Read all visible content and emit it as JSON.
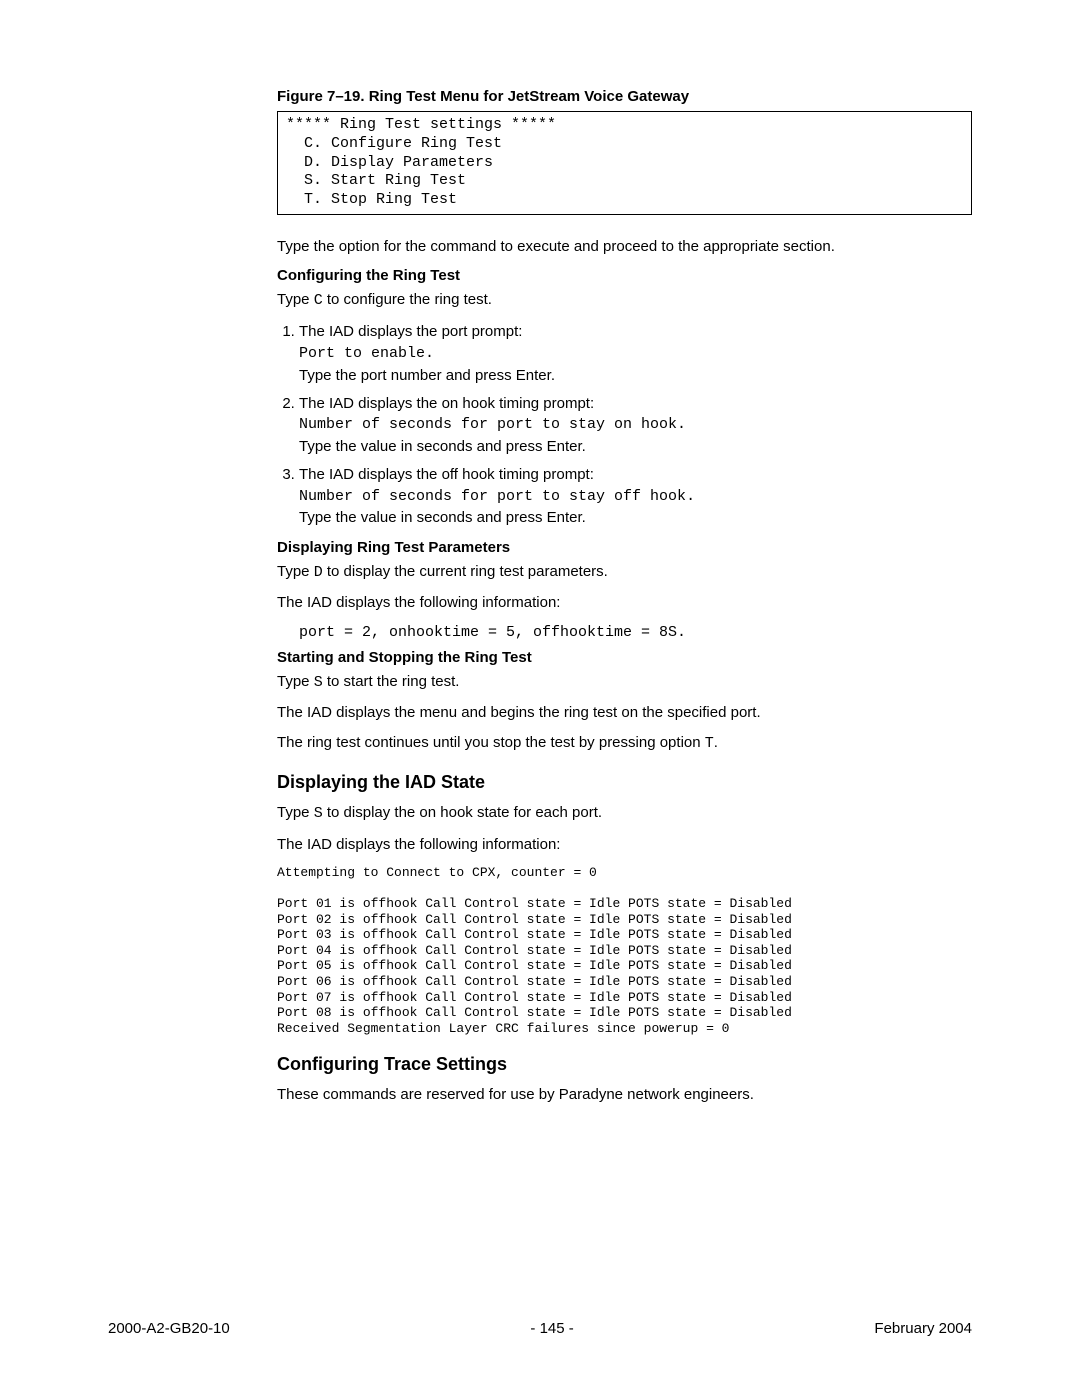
{
  "figure_caption": "Figure 7–19.  Ring Test Menu for JetStream Voice Gateway",
  "terminal": "***** Ring Test settings *****\n  C. Configure Ring Test\n  D. Display Parameters\n  S. Start Ring Test\n  T. Stop Ring Test",
  "intro": "Type the option for the command to execute and proceed to the appropriate section.",
  "config_heading": "Configuring the Ring Test",
  "config_type_prefix": "Type ",
  "config_type_code": "C",
  "config_type_suffix": " to configure the ring test.",
  "steps": [
    {
      "lead": "The IAD displays the port prompt:",
      "code": "Port to enable.",
      "tail": "Type the port number and press Enter."
    },
    {
      "lead": "The IAD displays the on hook timing prompt:",
      "code": "Number of seconds for port to stay on hook.",
      "tail": "Type the value in seconds and press Enter."
    },
    {
      "lead": "The IAD displays the off hook timing prompt:",
      "code": "Number of seconds for port to stay off hook.",
      "tail": "Type the value in seconds and press Enter."
    }
  ],
  "display_params_heading": "Displaying Ring Test Parameters",
  "display_type_prefix": "Type ",
  "display_type_code": "D",
  "display_type_suffix": " to display the current ring test parameters.",
  "display_info": "The IAD displays the following information:",
  "display_output": "port = 2, onhooktime = 5, offhooktime = 8S.",
  "startstop_heading": "Starting and Stopping the Ring Test",
  "start_type_prefix": "Type ",
  "start_type_code": "S",
  "start_type_suffix": " to start the ring test.",
  "start_info": "The IAD displays the menu and begins the ring test on the specified port.",
  "stop_info_prefix": "The ring test continues until you stop the test by pressing option ",
  "stop_info_code": "T",
  "stop_info_suffix": ".",
  "iad_state_heading": "Displaying the IAD State",
  "iad_type_prefix": "Type ",
  "iad_type_code": "S",
  "iad_type_suffix": " to display the on hook state for each port.",
  "iad_info": "The IAD displays the following information:",
  "port_dump": "Attempting to Connect to CPX, counter = 0\n\nPort 01 is offhook Call Control state = Idle POTS state = Disabled\nPort 02 is offhook Call Control state = Idle POTS state = Disabled\nPort 03 is offhook Call Control state = Idle POTS state = Disabled\nPort 04 is offhook Call Control state = Idle POTS state = Disabled\nPort 05 is offhook Call Control state = Idle POTS state = Disabled\nPort 06 is offhook Call Control state = Idle POTS state = Disabled\nPort 07 is offhook Call Control state = Idle POTS state = Disabled\nPort 08 is offhook Call Control state = Idle POTS state = Disabled\nReceived Segmentation Layer CRC failures since powerup = 0",
  "trace_heading": "Configuring Trace Settings",
  "trace_body": "These commands are reserved for use by Paradyne network engineers.",
  "footer": {
    "left": "2000-A2-GB20-10",
    "center": "- 145 -",
    "right": "February 2004"
  }
}
